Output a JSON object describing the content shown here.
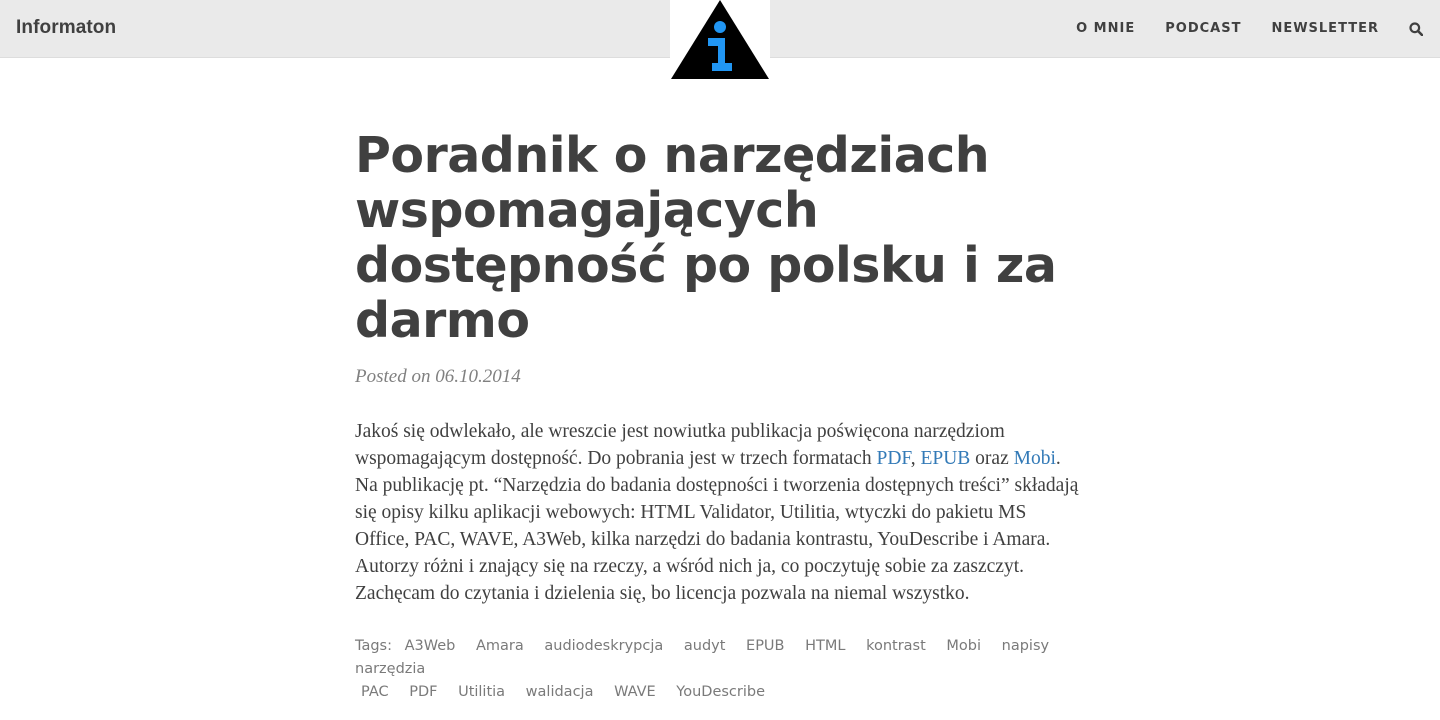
{
  "navbar": {
    "brand": "Informaton",
    "items": [
      "O MNIE",
      "PODCAST",
      "NEWSLETTER"
    ],
    "search_icon": "search-icon",
    "logo_icon": "info-triangle-logo",
    "colors": {
      "background": "#eaeaea",
      "logo_accent": "#2196f3"
    }
  },
  "post": {
    "title": "Poradnik o narzędziach wspomagających dostępność po polsku i za darmo",
    "meta": "Posted on 06.10.2014",
    "body": {
      "p1_a": "Jakoś się odwlekało, ale wreszcie jest nowiutka publikacja poświęcona narzędziom wspomagającym dostępność. Do pobrania jest w trzech formatach ",
      "link_pdf": "PDF",
      "sep1": ", ",
      "link_epub": "EPUB",
      "sep2": " oraz ",
      "link_mobi": "Mobi",
      "p1_b": ". Na publikację pt. “Narzędzia do badania dostępności i tworzenia dostępnych treści” składają się opisy kilku aplikacji webowych: HTML Validator, Utilitia, wtyczki do pakietu MS Office, PAC, WAVE, A3Web, kilka narzędzi do badania kontrastu, YouDescribe i Amara. Autorzy różni i znający się na rzeczy, a wśród nich ja, co poczytuję sobie za zaszczyt. Zachęcam do czytania i dzielenia się, bo licencja pozwala na niemal wszystko."
    },
    "tags_label": "Tags:",
    "tags_row1": [
      "A3Web",
      "Amara",
      "audiodeskrypcja",
      "audyt",
      "EPUB",
      "HTML",
      "kontrast",
      "Mobi",
      "napisy",
      "narzędzia"
    ],
    "tags_row2": [
      "PAC",
      "PDF",
      "Utilitia",
      "walidacja",
      "WAVE",
      "YouDescribe"
    ]
  }
}
